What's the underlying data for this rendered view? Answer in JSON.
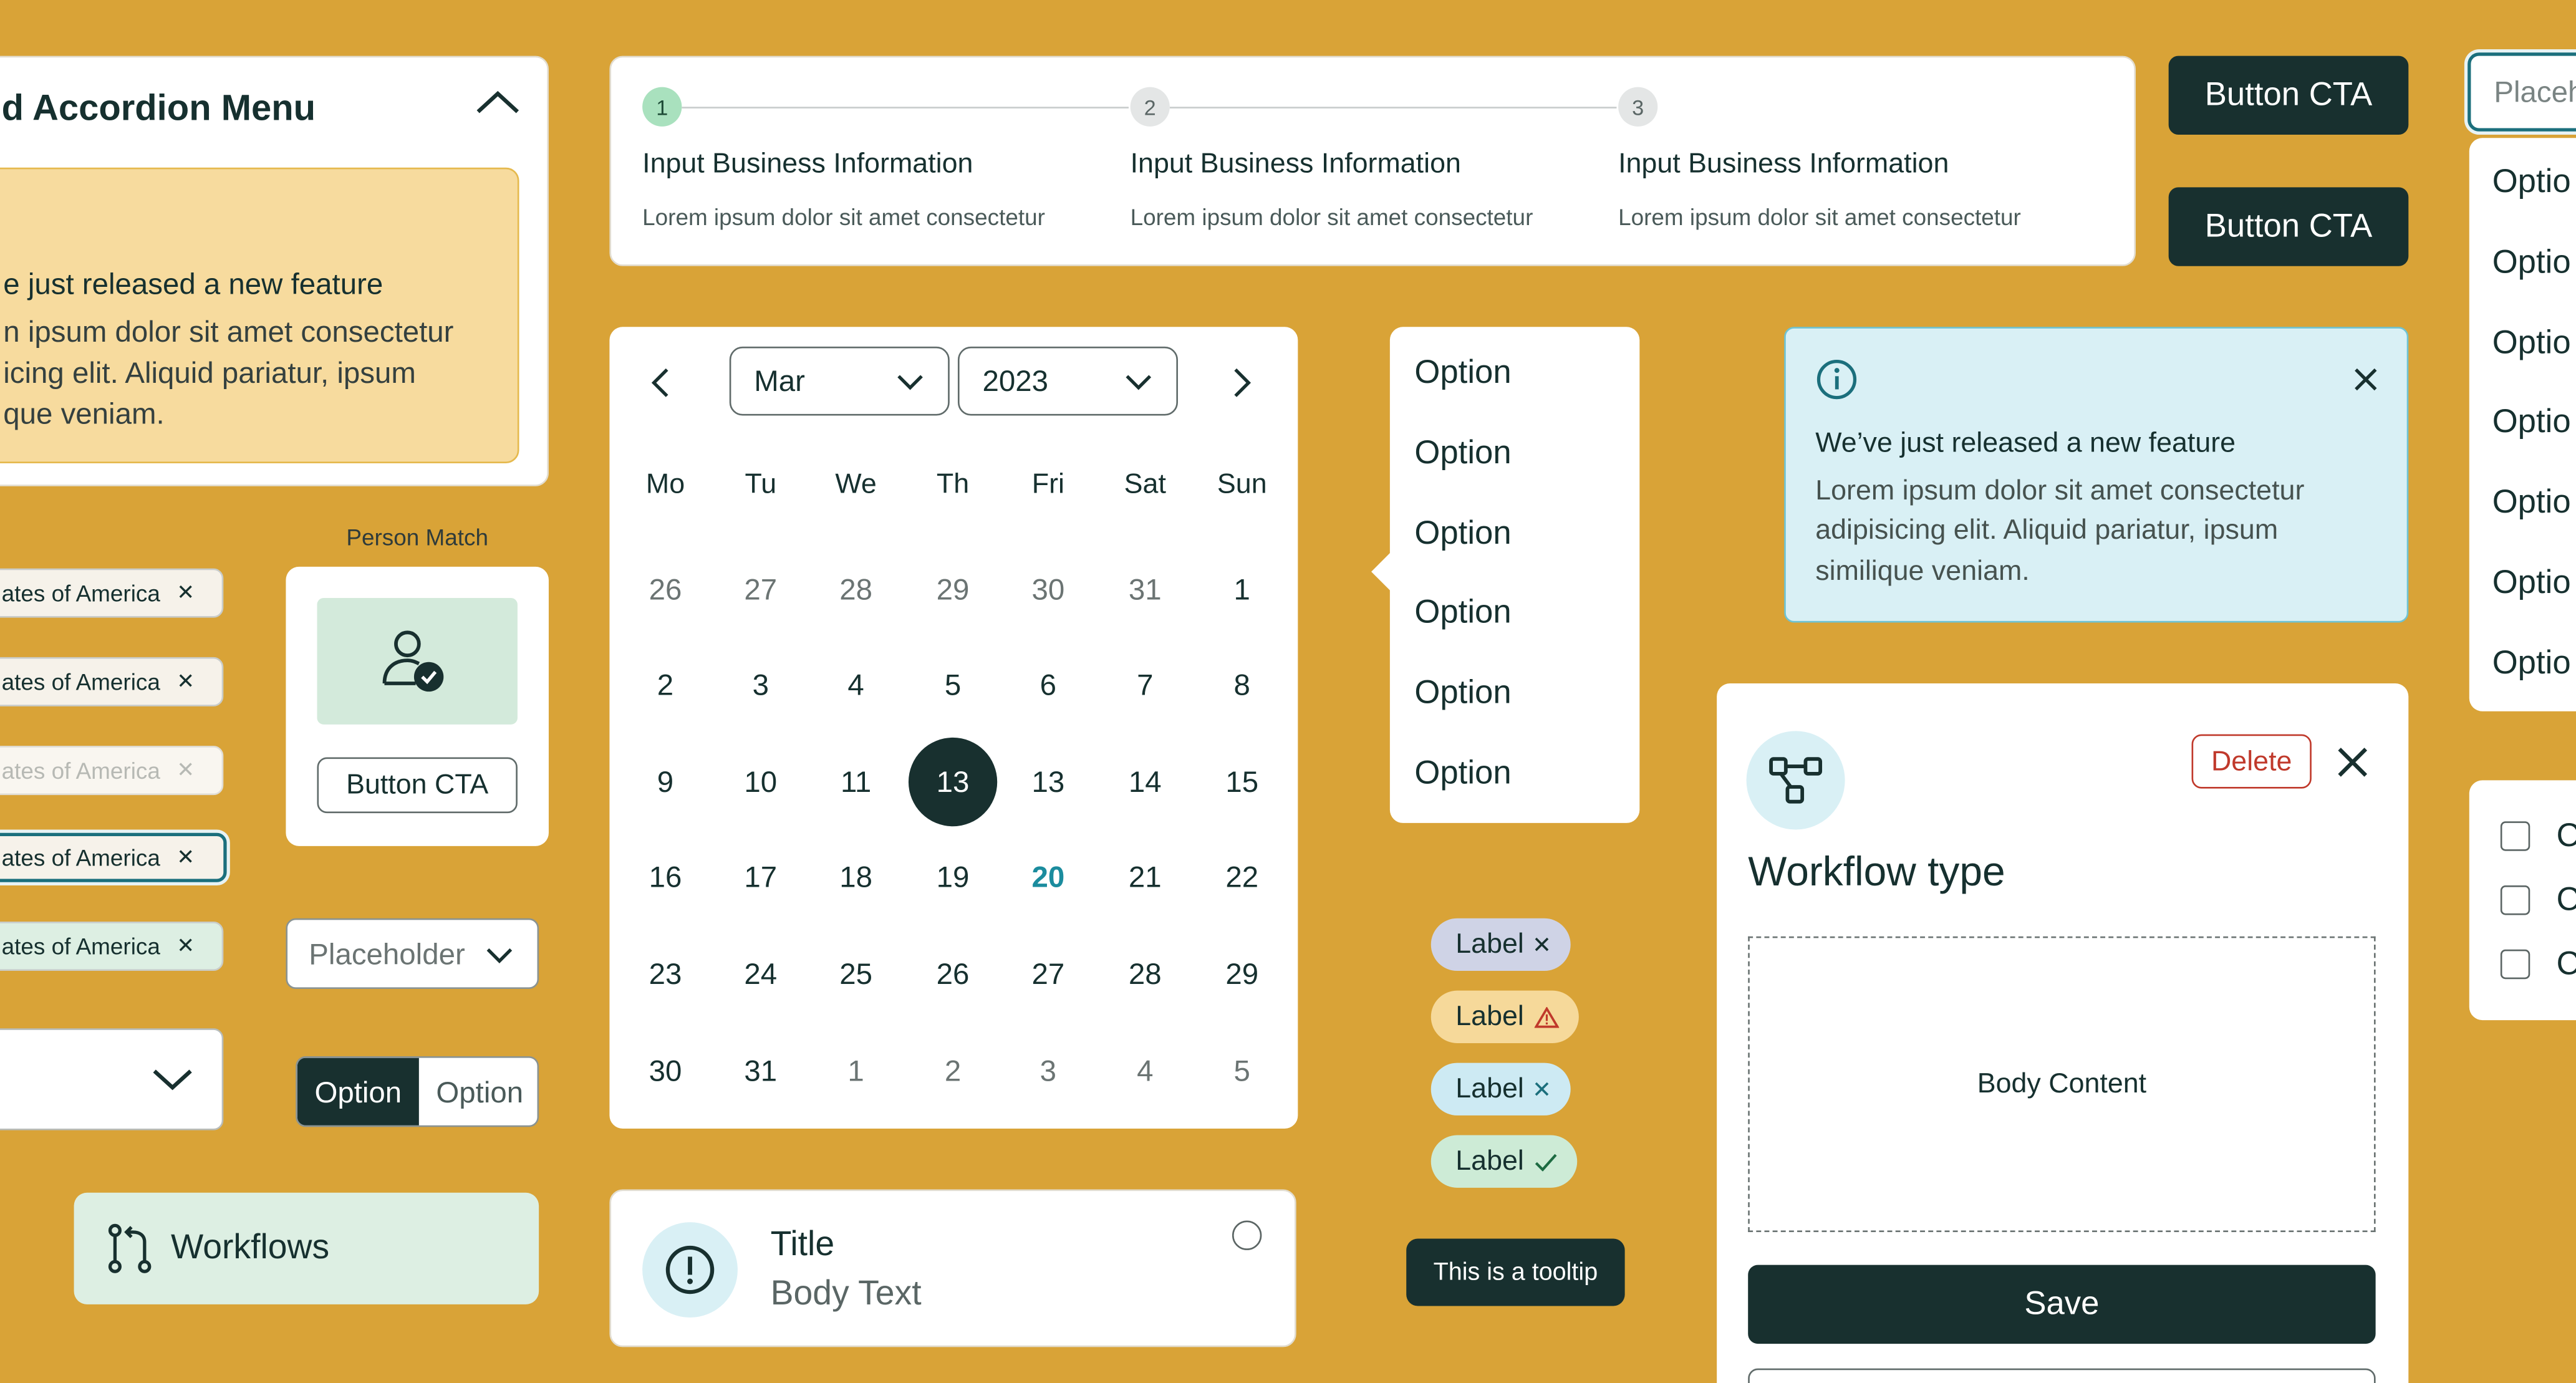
{
  "accordion": {
    "title": "d Accordion Menu",
    "alert_title": "e just released a new feature",
    "alert_body_1": "n ipsum dolor sit amet consectetur",
    "alert_body_2": "icing elit. Aliquid pariatur, ipsum",
    "alert_body_3": "que veniam."
  },
  "stepper": {
    "steps": [
      {
        "num": "1",
        "title": "Input Business Information",
        "desc": "Lorem ipsum dolor sit amet consectetur"
      },
      {
        "num": "2",
        "title": "Input Business Information",
        "desc": "Lorem ipsum dolor sit amet consectetur"
      },
      {
        "num": "3",
        "title": "Input Business Information",
        "desc": "Lorem ipsum dolor sit amet consectetur"
      }
    ]
  },
  "cta": {
    "top": "Button CTA",
    "bottom": "Button CTA"
  },
  "right_select": {
    "placeholder": "Placeh",
    "options": [
      "Optio",
      "Optio",
      "Optio",
      "Optio",
      "Optio",
      "Optio",
      "Optio"
    ]
  },
  "calendar": {
    "month": "Mar",
    "year": "2023",
    "weekdays": [
      "Mo",
      "Tu",
      "We",
      "Th",
      "Fri",
      "Sat",
      "Sun"
    ],
    "weeks": [
      [
        "26",
        "27",
        "28",
        "29",
        "30",
        "31",
        "1"
      ],
      [
        "2",
        "3",
        "4",
        "5",
        "6",
        "7",
        "8"
      ],
      [
        "9",
        "10",
        "11",
        "13",
        "13",
        "14",
        "15"
      ],
      [
        "16",
        "17",
        "18",
        "19",
        "20",
        "21",
        "22"
      ],
      [
        "23",
        "24",
        "25",
        "26",
        "27",
        "28",
        "29"
      ],
      [
        "30",
        "31",
        "1",
        "2",
        "3",
        "4",
        "5"
      ]
    ],
    "selected": "13",
    "today": "20"
  },
  "option_list": [
    "Option",
    "Option",
    "Option",
    "Option",
    "Option",
    "Option"
  ],
  "info_alert": {
    "title": "We’ve just released a new feature",
    "body_1": "Lorem ipsum dolor sit amet consectetur",
    "body_2": "adipisicing elit. Aliquid pariatur, ipsum",
    "body_3": "similique veniam."
  },
  "chips": [
    "ates of America",
    "ates of America",
    "ates of America",
    "ates of America",
    "ates of America"
  ],
  "person_match": {
    "label": "Person Match",
    "button": "Button CTA"
  },
  "placeholder_select": "Placeholder",
  "segmented": {
    "first": "Option",
    "second": "Option"
  },
  "workflows_nav": "Workflows",
  "notification": {
    "title": "Title",
    "body": "Body Text"
  },
  "labels": [
    "Label",
    "Label",
    "Label",
    "Label"
  ],
  "label_colors": [
    "#CFD3E6",
    "#F6D99A",
    "#CDEAF3",
    "#CDEBD6"
  ],
  "tooltip": "This is a tooltip",
  "workflow_panel": {
    "delete": "Delete",
    "title": "Workflow type",
    "body": "Body Content",
    "save": "Save"
  },
  "checkbox_labels": [
    "C",
    "C",
    "C"
  ],
  "colors": {
    "background": "#D9A337",
    "dark": "#18302F",
    "accent_teal": "#1B8C9E",
    "danger": "#C0392B"
  }
}
